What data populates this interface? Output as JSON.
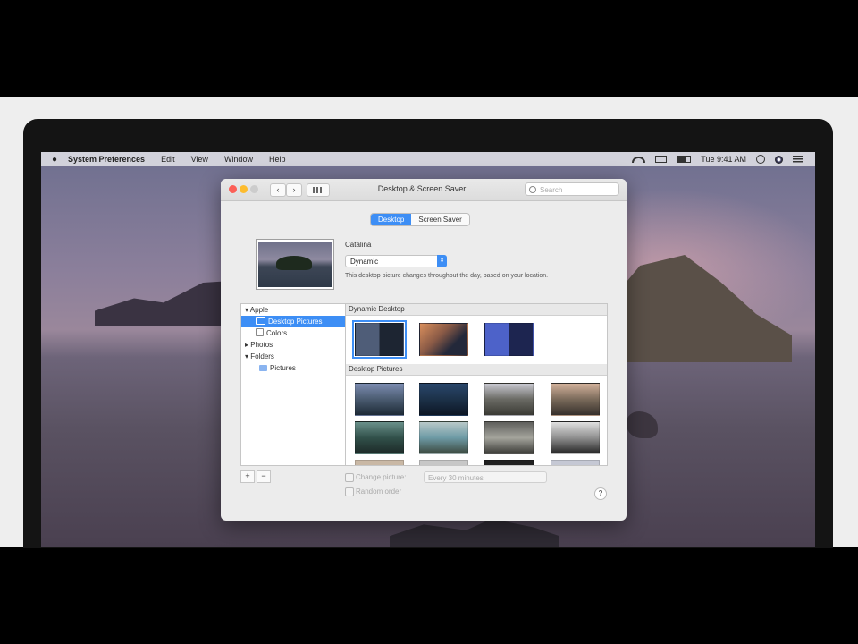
{
  "menubar": {
    "items": [
      "System Preferences",
      "Edit",
      "View",
      "Window",
      "Help"
    ],
    "clock": "Tue 9:41 AM",
    "icons": [
      "apple-icon",
      "wifi-icon",
      "airplay-icon",
      "battery-icon",
      "spotlight-icon",
      "siri-icon",
      "notification-center-icon"
    ]
  },
  "window": {
    "title": "Desktop & Screen Saver",
    "search_placeholder": "Search",
    "tabs": [
      "Desktop",
      "Screen Saver"
    ],
    "active_tab": "Desktop",
    "current_picture_name": "Catalina",
    "popup_value": "Dynamic",
    "description": "This desktop picture changes throughout the day, based on your location."
  },
  "sidebar": {
    "apple_group": "Apple",
    "desktop_pictures": "Desktop Pictures",
    "colors": "Colors",
    "photos": "Photos",
    "folders": "Folders",
    "pictures": "Pictures"
  },
  "gallery": {
    "section_dynamic": "Dynamic Desktop",
    "section_pictures": "Desktop Pictures"
  },
  "footer": {
    "add_label": "+",
    "remove_label": "−",
    "change_picture": "Change picture:",
    "interval": "Every 30 minutes",
    "random_order": "Random order",
    "help": "?"
  },
  "colors": {
    "accent": "#3d8ef5",
    "window_bg": "#ececec",
    "close": "#fc5f57",
    "minimize": "#fdbc2e"
  }
}
